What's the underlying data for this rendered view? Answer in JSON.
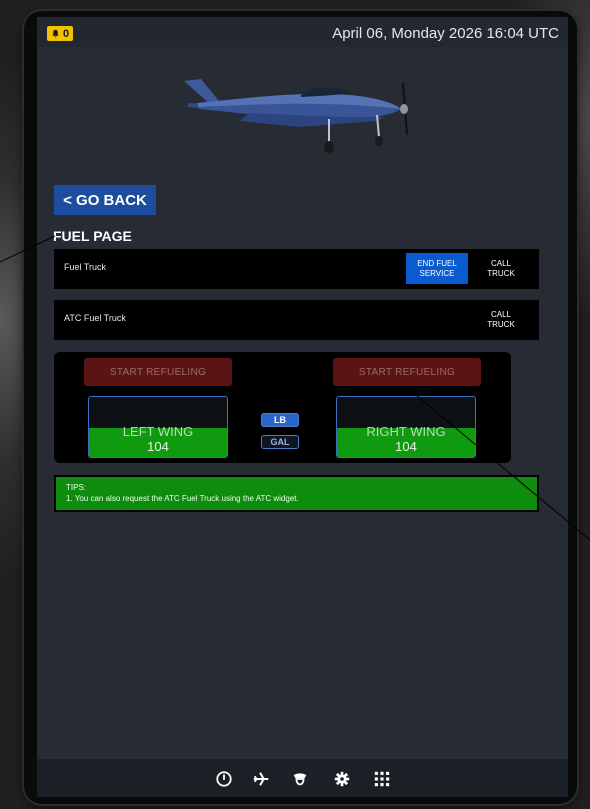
{
  "topbar": {
    "notification_count": "0",
    "datetime": "April 06, Monday 2026 16:04 UTC",
    "bell_color": "#f2c200"
  },
  "navigation": {
    "back_label": "< GO BACK"
  },
  "page": {
    "title": "FUEL PAGE"
  },
  "services": [
    {
      "label": "Fuel Truck",
      "end_label_1": "END FUEL",
      "end_label_2": "SERVICE",
      "call_label_1": "CALL",
      "call_label_2": "TRUCK"
    },
    {
      "label": "ATC Fuel Truck",
      "call_label_1": "CALL",
      "call_label_2": "TRUCK"
    }
  ],
  "refuel": {
    "left": {
      "button": "START REFUELING",
      "wing_label": "LEFT WING",
      "value": "104",
      "fill_fraction": 0.48
    },
    "right": {
      "button": "START REFUELING",
      "wing_label": "RIGHT WING",
      "value": "104",
      "fill_fraction": 0.48
    },
    "units": {
      "lb": "LB",
      "gal": "GAL",
      "selected": "LB"
    }
  },
  "tips": {
    "heading": "TIPS:",
    "line1": "1. You can also request the ATC Fuel Truck using the ATC widget."
  },
  "bottom_nav": {
    "icons": [
      "compass-icon",
      "airplane-icon",
      "pilot-icon",
      "gear-icon",
      "grid-icon"
    ]
  },
  "colors": {
    "accent_blue": "#1c4d9e",
    "start_button": "#5a1414",
    "fuel_green": "#0f9a0f",
    "tips_green": "#0e8c0e"
  }
}
